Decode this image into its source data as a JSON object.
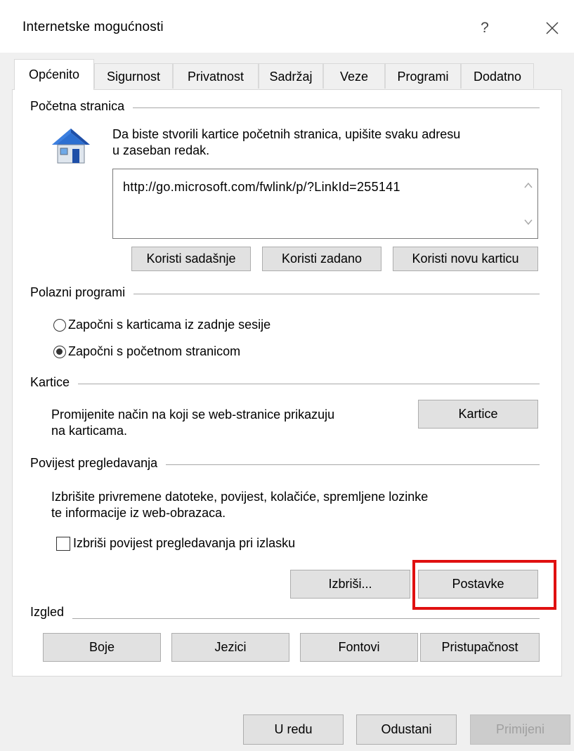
{
  "window": {
    "title": "Internetske mogućnosti",
    "help_label": "?"
  },
  "tabs": [
    {
      "label": "Općenito"
    },
    {
      "label": "Sigurnost"
    },
    {
      "label": "Privatnost"
    },
    {
      "label": "Sadržaj"
    },
    {
      "label": "Veze"
    },
    {
      "label": "Programi"
    },
    {
      "label": "Dodatno"
    }
  ],
  "home_page": {
    "group_label": "Početna stranica",
    "description_line1": "Da biste stvorili kartice početnih stranica, upišite svaku adresu",
    "description_line2": "u zaseban redak.",
    "url_value": "http://go.microsoft.com/fwlink/p/?LinkId=255141",
    "btn_current": "Koristi sadašnje",
    "btn_default": "Koristi zadano",
    "btn_new_tab": "Koristi novu karticu",
    "icon": "house-icon"
  },
  "startup": {
    "group_label": "Polazni programi",
    "option_last_session": "Započni s karticama iz zadnje sesije",
    "option_home_page": "Započni s početnom stranicom",
    "selected": "option_home_page"
  },
  "tabs_section": {
    "group_label": "Kartice",
    "description_line1": "Promijenite način na koji se web-stranice prikazuju",
    "description_line2": "na karticama.",
    "button": "Kartice"
  },
  "history": {
    "group_label": "Povijest pregledavanja",
    "description_line1": "Izbrišite privremene datoteke, povijest, kolačiće, spremljene lozinke",
    "description_line2": "te informacije iz web-obrazaca.",
    "checkbox_label": "Izbriši povijest pregledavanja pri izlasku",
    "checkbox_checked": false,
    "btn_delete": "Izbriši...",
    "btn_settings": "Postavke",
    "highlight_color": "#e01010"
  },
  "appearance": {
    "group_label": "Izgled",
    "btn_colors": "Boje",
    "btn_languages": "Jezici",
    "btn_fonts": "Fontovi",
    "btn_accessibility": "Pristupačnost"
  },
  "footer": {
    "btn_ok": "U redu",
    "btn_cancel": "Odustani",
    "btn_apply": "Primijeni"
  }
}
